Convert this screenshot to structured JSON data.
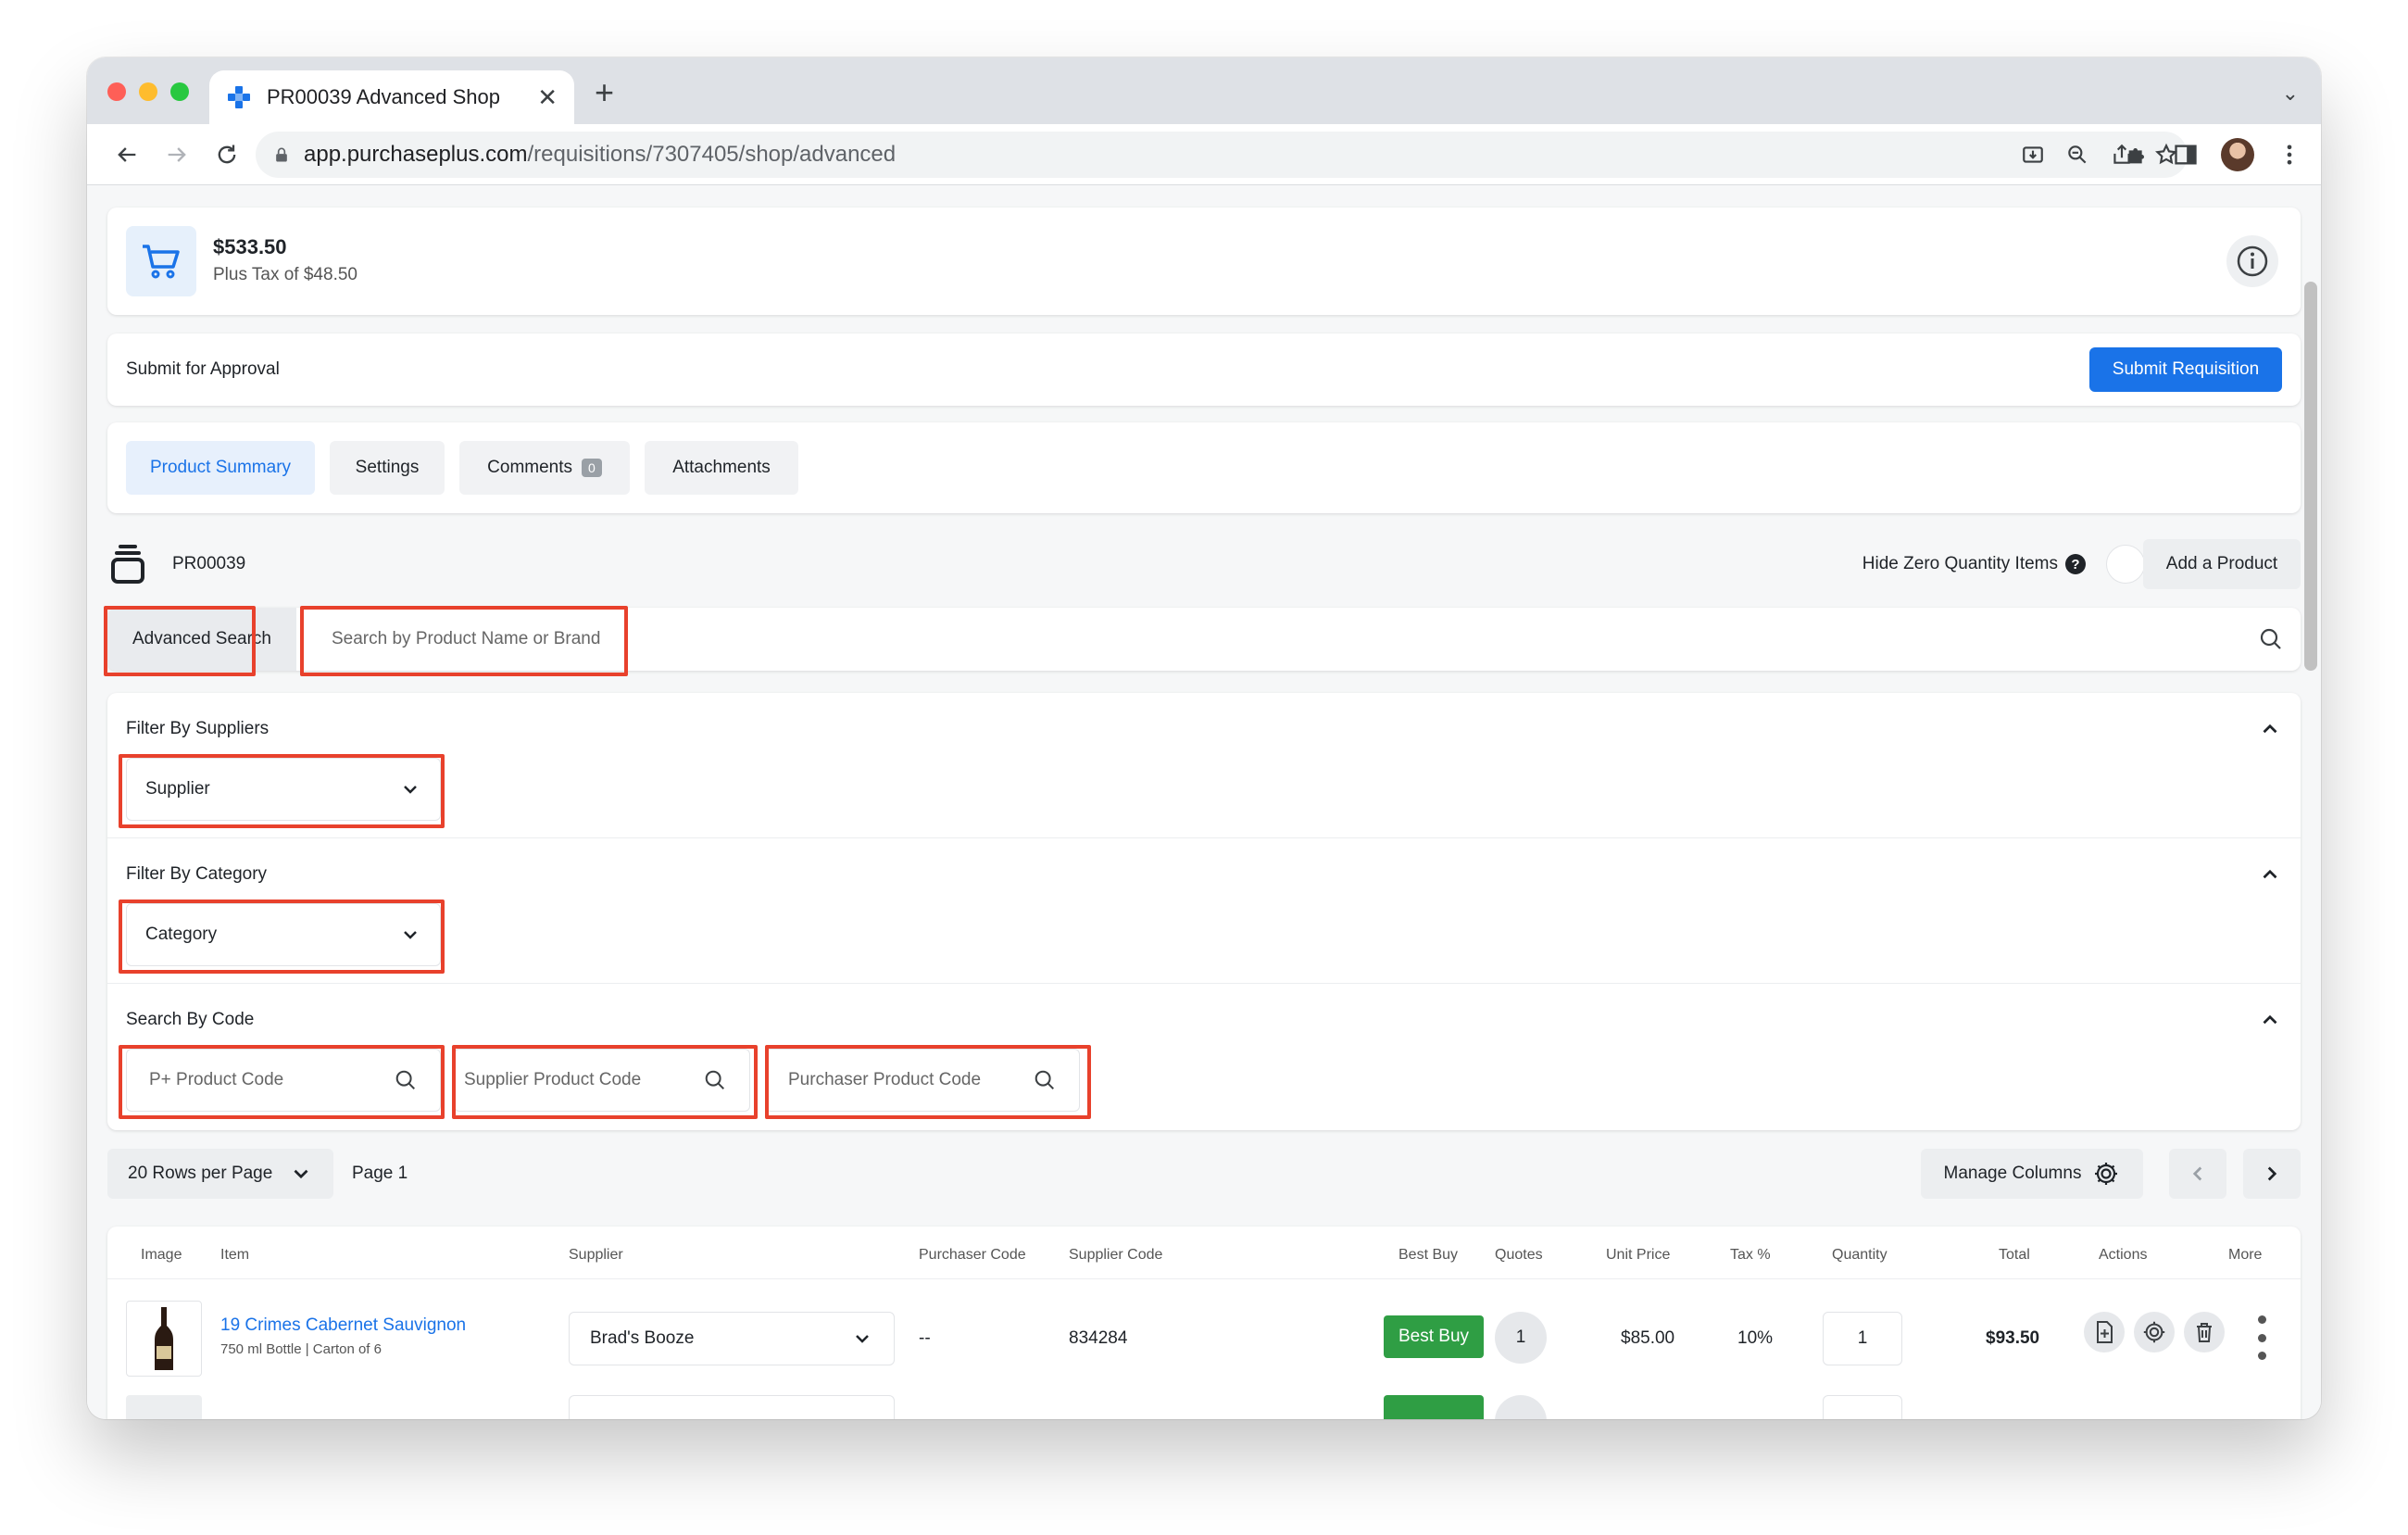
{
  "browser": {
    "tab_title": "PR00039 Advanced Shop",
    "url_domain": "app.purchaseplus.com",
    "url_path": "/requisitions/7307405/shop/advanced"
  },
  "summary": {
    "total": "$533.50",
    "tax": "Plus Tax of $48.50"
  },
  "approval": {
    "label": "Submit for Approval",
    "submit_label": "Submit Requisition"
  },
  "tabs": [
    {
      "label": "Product Summary",
      "active": true
    },
    {
      "label": "Settings"
    },
    {
      "label": "Comments",
      "badge": "0"
    },
    {
      "label": "Attachments"
    }
  ],
  "requisition": {
    "code": "PR00039",
    "hide_zero_label": "Hide Zero Quantity Items",
    "add_product_label": "Add a Product"
  },
  "search": {
    "advanced_label": "Advanced Search",
    "placeholder": "Search by Product Name or Brand"
  },
  "filters": {
    "suppliers_title": "Filter By Suppliers",
    "supplier_select": "Supplier",
    "category_title": "Filter By Category",
    "category_select": "Category",
    "code_title": "Search By Code",
    "code_inputs": [
      "P+ Product Code",
      "Supplier Product Code",
      "Purchaser Product Code"
    ]
  },
  "pager": {
    "rows_per_page": "20 Rows per Page",
    "page": "Page 1",
    "manage_columns": "Manage Columns"
  },
  "table": {
    "headers": [
      "Image",
      "Item",
      "Supplier",
      "Purchaser Code",
      "Supplier Code",
      "Best Buy",
      "Quotes",
      "Unit Price",
      "Tax %",
      "Quantity",
      "Total",
      "Actions",
      "More"
    ],
    "rows": [
      {
        "item": "19 Crimes Cabernet Sauvignon",
        "sub": "750 ml Bottle | Carton of 6",
        "supplier": "Brad's Booze",
        "purchaser_code": "--",
        "supplier_code": "834284",
        "best_buy": "Best Buy",
        "quotes": "1",
        "unit_price": "$85.00",
        "tax": "10%",
        "quantity": "1",
        "total": "$93.50"
      }
    ]
  },
  "colors": {
    "primary": "#1a73e8",
    "best_buy": "#2f9e44",
    "highlight": "#e8412c"
  }
}
